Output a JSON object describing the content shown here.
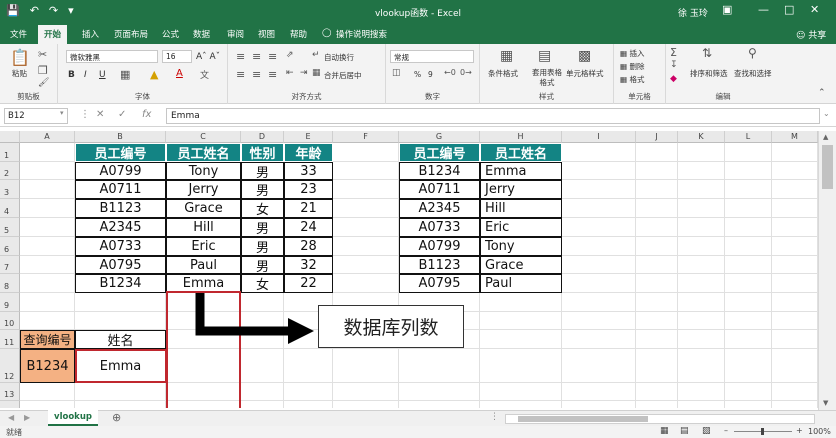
{
  "window": {
    "title": "vlookup函数 - Excel",
    "user": "徐 玉玲",
    "share": "共享",
    "tell_me": "操作说明搜索"
  },
  "tabs": [
    "文件",
    "开始",
    "插入",
    "页面布局",
    "公式",
    "数据",
    "审阅",
    "视图",
    "帮助"
  ],
  "active_tab": "开始",
  "ribbon": {
    "clipboard": {
      "label": "剪贴板",
      "paste": "粘贴"
    },
    "font": {
      "label": "字体",
      "name": "微软雅黑",
      "size": "16",
      "bold": "B",
      "italic": "I",
      "underline": "U"
    },
    "alignment": {
      "label": "对齐方式",
      "wrap": "自动换行",
      "merge": "合并后居中"
    },
    "number": {
      "label": "数字",
      "format": "常规",
      "percent": "%",
      "comma": "9"
    },
    "styles": {
      "label": "样式",
      "conditional": "条件格式",
      "table": "套用表格格式",
      "cell": "单元格样式"
    },
    "cells": {
      "label": "单元格",
      "insert": "插入",
      "delete": "删除",
      "format": "格式"
    },
    "editing": {
      "label": "编辑",
      "sort": "排序和筛选",
      "find": "查找和选择"
    }
  },
  "formula_bar": {
    "name_box": "B12",
    "fx": "fx",
    "content": "Emma"
  },
  "columns": [
    "A",
    "B",
    "C",
    "D",
    "E",
    "F",
    "G",
    "H",
    "I",
    "J",
    "K",
    "L",
    "M"
  ],
  "rows": [
    "1",
    "2",
    "3",
    "4",
    "5",
    "6",
    "7",
    "8",
    "9",
    "10",
    "11",
    "12",
    "13",
    "14"
  ],
  "table1": {
    "headers": [
      "员工编号",
      "员工姓名",
      "性别",
      "年龄"
    ],
    "rows": [
      [
        "A0799",
        "Tony",
        "男",
        "33"
      ],
      [
        "A0711",
        "Jerry",
        "男",
        "23"
      ],
      [
        "B1123",
        "Grace",
        "女",
        "21"
      ],
      [
        "A2345",
        "Hill",
        "男",
        "24"
      ],
      [
        "A0733",
        "Eric",
        "男",
        "28"
      ],
      [
        "A0795",
        "Paul",
        "男",
        "32"
      ],
      [
        "B1234",
        "Emma",
        "女",
        "22"
      ]
    ]
  },
  "table2": {
    "headers": [
      "员工编号",
      "员工姓名"
    ],
    "rows": [
      [
        "B1234",
        "Emma"
      ],
      [
        "A0711",
        "Jerry"
      ],
      [
        "A2345",
        "Hill"
      ],
      [
        "A0733",
        "Eric"
      ],
      [
        "A0799",
        "Tony"
      ],
      [
        "B1123",
        "Grace"
      ],
      [
        "A0795",
        "Paul"
      ]
    ]
  },
  "lookup": {
    "label_id": "查询编号",
    "label_name": "姓名",
    "id_value": "B1234",
    "name_value": "Emma"
  },
  "annotation": "数据库列数",
  "sheet_tab": "vlookup",
  "status": {
    "left": "就绪",
    "zoom": "100%"
  },
  "colors": {
    "excel_green": "#217346",
    "header_teal": "#138484",
    "highlight_red": "#c0282f",
    "lookup_orange": "#f4b183"
  }
}
